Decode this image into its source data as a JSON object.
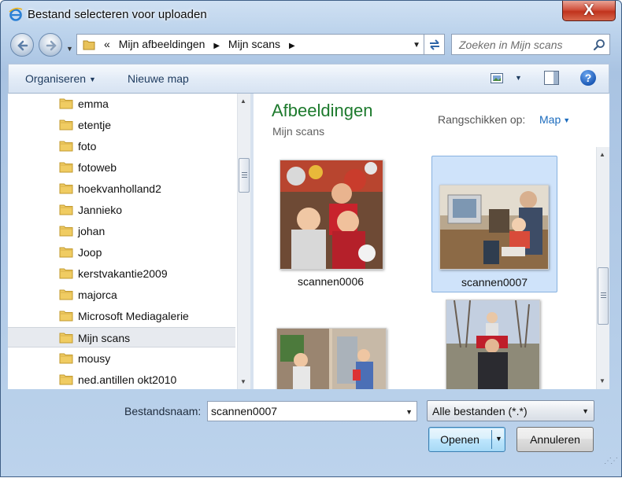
{
  "window": {
    "title": "Bestand selecteren voor uploaden",
    "close_label": "X"
  },
  "navigation": {
    "breadcrumb_overflow": "«",
    "breadcrumbs": [
      "Mijn afbeeldingen",
      "Mijn scans"
    ],
    "search_placeholder": "Zoeken in Mijn scans"
  },
  "toolbar": {
    "organize_label": "Organiseren",
    "new_folder_label": "Nieuwe map"
  },
  "folder_tree": {
    "items": [
      {
        "label": "emma",
        "selected": false
      },
      {
        "label": "etentje",
        "selected": false
      },
      {
        "label": "foto",
        "selected": false
      },
      {
        "label": "fotoweb",
        "selected": false
      },
      {
        "label": "hoekvanholland2",
        "selected": false
      },
      {
        "label": "Jannieko",
        "selected": false
      },
      {
        "label": "johan",
        "selected": false
      },
      {
        "label": "Joop",
        "selected": false
      },
      {
        "label": "kerstvakantie2009",
        "selected": false
      },
      {
        "label": "majorca",
        "selected": false
      },
      {
        "label": "Microsoft Mediagalerie",
        "selected": false
      },
      {
        "label": "Mijn scans",
        "selected": true
      },
      {
        "label": "mousy",
        "selected": false
      },
      {
        "label": "ned.antillen okt2010",
        "selected": false
      }
    ]
  },
  "content": {
    "library_title": "Afbeeldingen",
    "library_subtitle": "Mijn scans",
    "arrange_label": "Rangschikken op:",
    "arrange_value": "Map",
    "files": [
      {
        "name": "scannen0006",
        "selected": false
      },
      {
        "name": "scannen0007",
        "selected": true
      },
      {
        "name": "",
        "selected": false
      },
      {
        "name": "",
        "selected": false
      }
    ]
  },
  "footer": {
    "filename_label": "Bestandsnaam:",
    "filename_value": "scannen0007",
    "filetype_value": "Alle bestanden (*.*)",
    "open_label": "Openen",
    "cancel_label": "Annuleren"
  },
  "colors": {
    "accent_title": "#1d7a2d",
    "link_blue": "#1b6bbd",
    "selection": "#cfe3fa",
    "close_red": "#c0331d"
  }
}
